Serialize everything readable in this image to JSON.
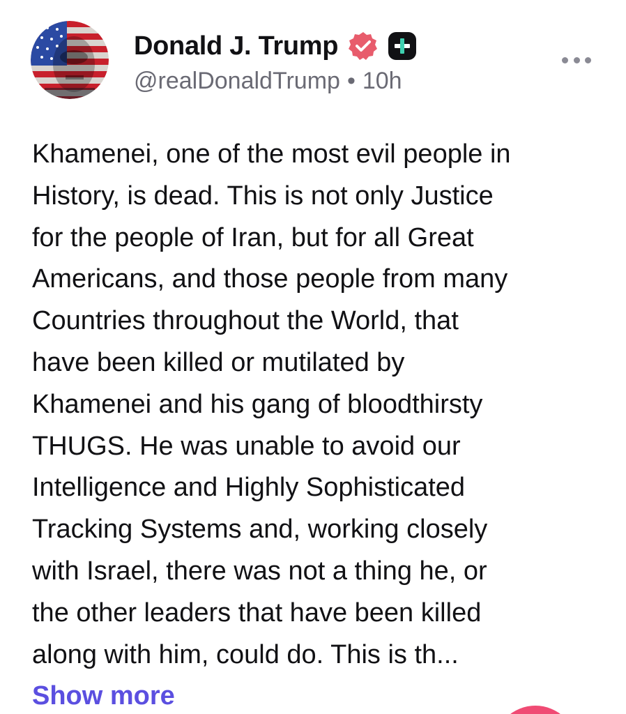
{
  "author": {
    "name": "Donald J. Trump",
    "handle": "@realDonaldTrump",
    "separator": "•",
    "time": "10h"
  },
  "post": {
    "lines": [
      "Khamenei, one of the most evil people in",
      "History, is dead. This is not only Justice",
      "for the people of Iran, but for all Great",
      "Americans, and those people from many",
      "Countries throughout the World, that",
      "have been killed or mutilated by",
      "Khamenei and his gang of bloodthirsty",
      "THUGS. He was unable to avoid our",
      "Intelligence and Highly Sophisticated",
      "Tracking Systems and, working closely",
      "with Israel, there was not a thing he, or",
      "the other leaders that have been killed",
      "along with him, could do. This is th..."
    ],
    "show_more_label": "Show more"
  },
  "icons": {
    "verified": "verified-badge-icon",
    "plus": "plus-badge-icon",
    "more": "more-options-icon"
  },
  "colors": {
    "verified": "#e85c6c",
    "link": "#5b4fe0",
    "muted": "#6a6a74",
    "plus_badge": "#111114",
    "plus_sign": "#3fd0b0"
  }
}
